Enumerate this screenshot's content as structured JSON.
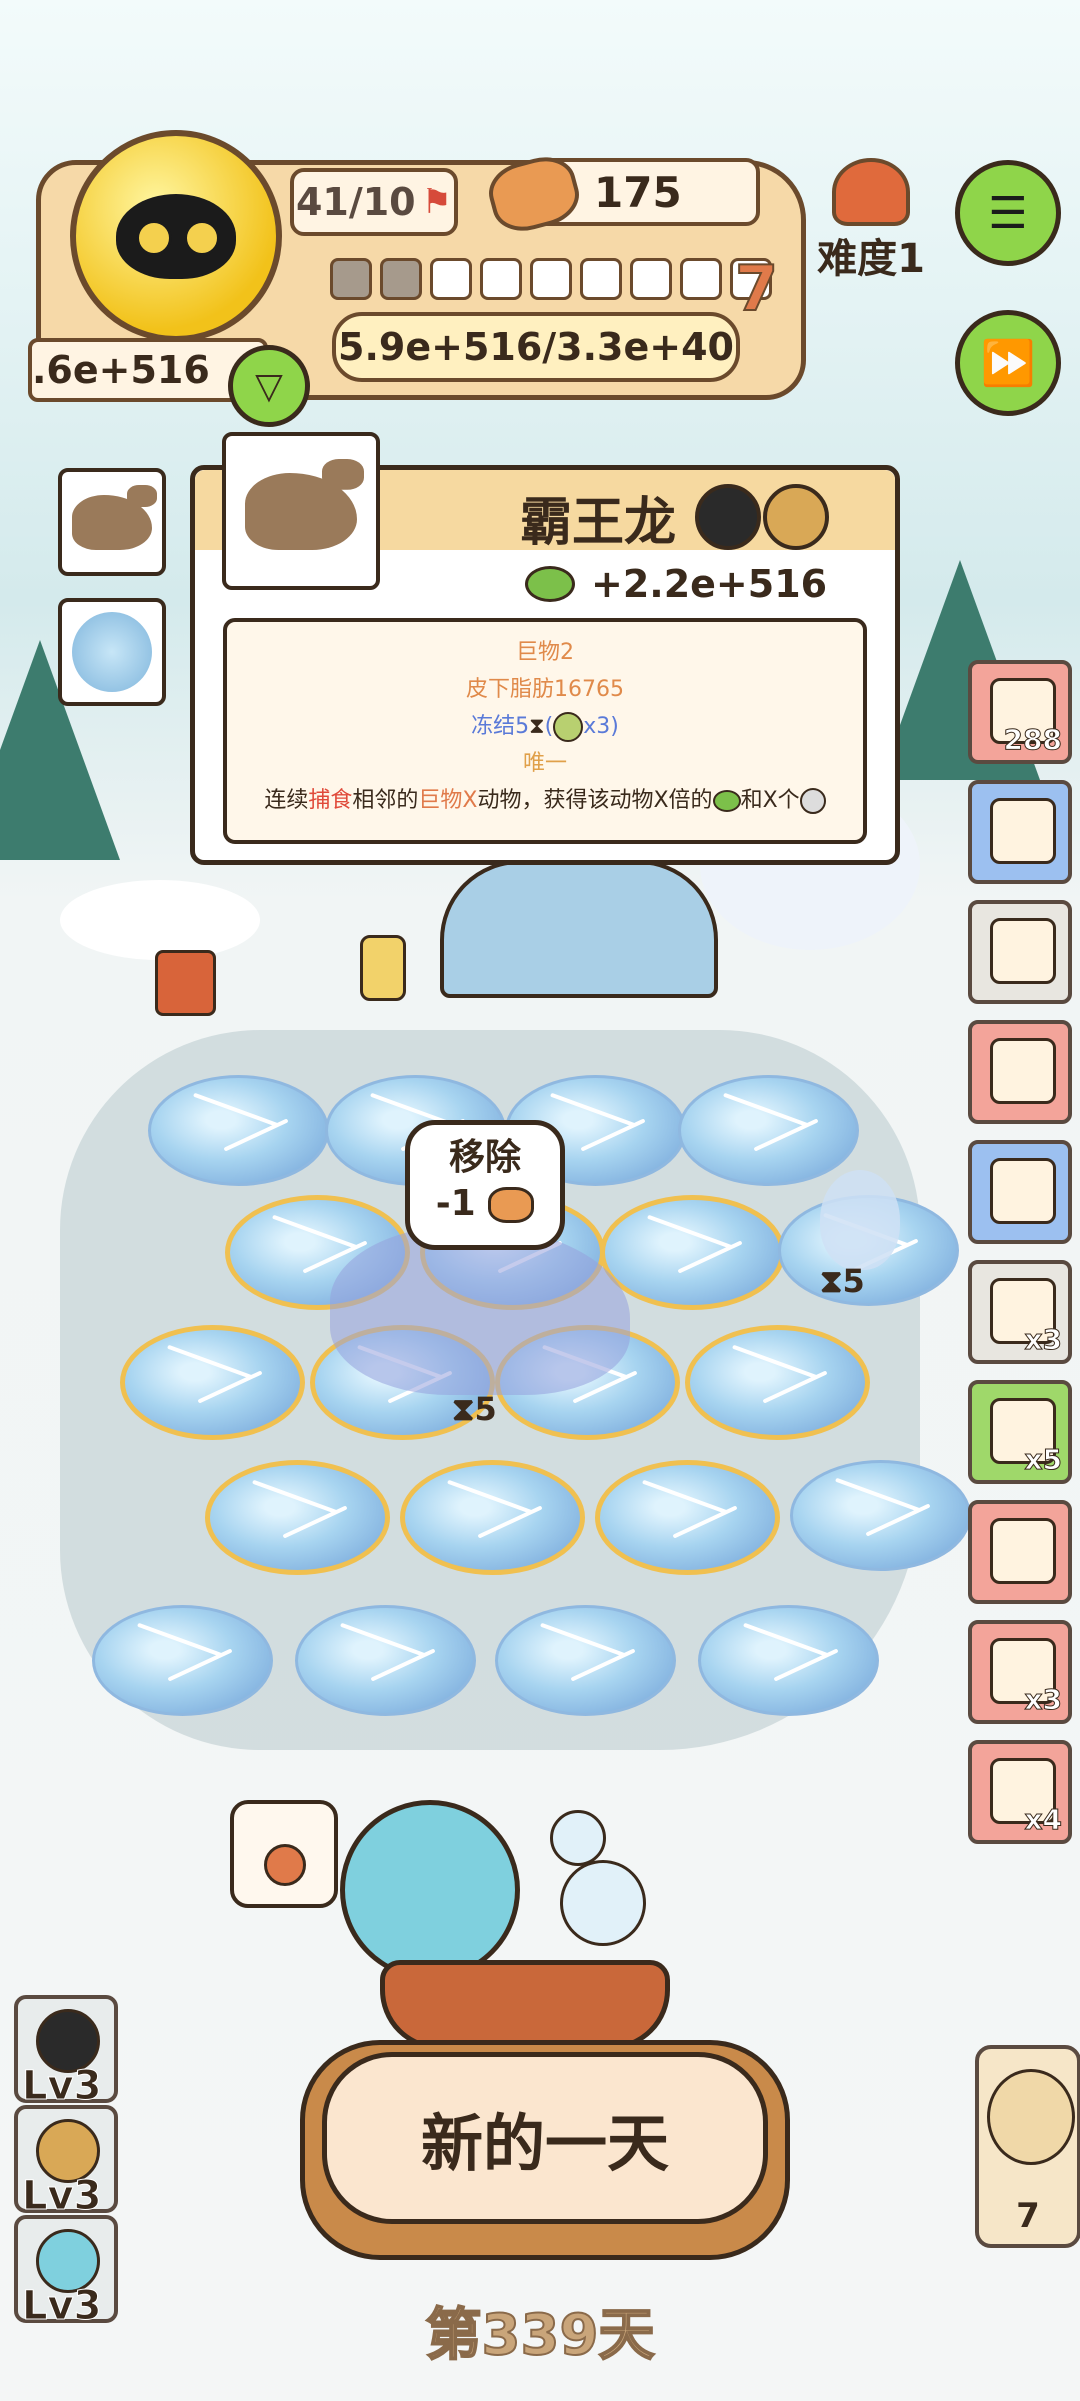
{
  "hud": {
    "level_progress": "41/10",
    "cans": "175",
    "difficulty": "难度1",
    "stage_number": "7",
    "progress_filled": 2,
    "progress_total": 9,
    "score": "5.9e+516/3.3e+40",
    "coins": ".6e+516"
  },
  "card": {
    "title": "霸王龙",
    "gain": "+2.2e+516",
    "lines": [
      {
        "text": "巨物2",
        "color": "#e08a4a"
      },
      {
        "text": "皮下脂肪16765",
        "color": "#e08a4a"
      },
      {
        "text": "冻结5",
        "color": "#5a7ad8"
      },
      {
        "text": "x3)",
        "color": "#5a7ad8"
      },
      {
        "text": "唯一",
        "color": "#e0a04a"
      }
    ],
    "desc_parts": [
      "连续",
      "捕食",
      "相邻的",
      "巨物X",
      "动物，获得该动物X倍的",
      "和X个"
    ]
  },
  "board": {
    "bubble_line1": "移除",
    "bubble_line2": "-1",
    "freeze_a": "5",
    "freeze_b": "5"
  },
  "items": [
    {
      "badge": "288",
      "bg": "#f3a49a"
    },
    {
      "badge": "",
      "bg": "#9cc0f0"
    },
    {
      "badge": "",
      "bg": "#e8e6e0"
    },
    {
      "badge": "",
      "bg": "#f3a49a"
    },
    {
      "badge": "",
      "bg": "#9cc0f0"
    },
    {
      "badge": "x3",
      "bg": "#e8e6e0"
    },
    {
      "badge": "x5",
      "bg": "#9fd86a"
    },
    {
      "badge": "",
      "bg": "#f3a49a"
    },
    {
      "badge": "x3",
      "bg": "#f3a49a"
    },
    {
      "badge": "x4",
      "bg": "#f3a49a"
    }
  ],
  "bottom": {
    "new_day": "新的一天",
    "day": "第339天",
    "owl_count": "7",
    "lv1": "Lv3",
    "lv2": "Lv3",
    "lv3": "Lv3"
  }
}
